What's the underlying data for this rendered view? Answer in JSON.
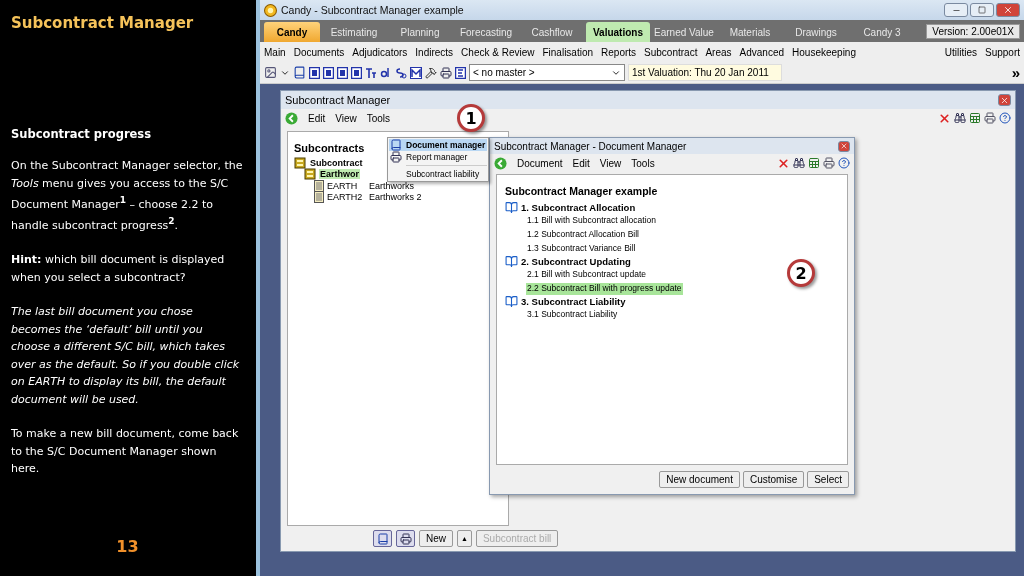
{
  "slide": {
    "title": "Subcontract Manager",
    "subtitle": "Subcontract progress",
    "paragraphs": [
      {
        "kind": "text",
        "text": "On the Subcontract Manager selector, the *Tools* menu gives you access to the S/C Document Manager$^{1}$ – choose 2.2 to handle subcontract progress$^{2}$."
      },
      {
        "kind": "text",
        "text": "**Hint:** which bill document is displayed when you select a subcontract?"
      },
      {
        "kind": "note",
        "text": "The last bill document you chose becomes the ‘default’ bill until you choose a different S/C bill, which takes over as the default.  So if you double click on EARTH to display its bill, the default document will be used."
      },
      {
        "kind": "text",
        "text": "To make a new bill document, come back to the S/C Document Manager shown here."
      }
    ],
    "page_number": "13"
  },
  "app": {
    "title": "Candy - Subcontract Manager example",
    "tabs": [
      {
        "label": "Candy",
        "kind": "brand",
        "selected": false
      },
      {
        "label": "Estimating",
        "kind": "tab",
        "selected": false
      },
      {
        "label": "Planning",
        "kind": "tab",
        "selected": false
      },
      {
        "label": "Forecasting",
        "kind": "tab",
        "selected": false
      },
      {
        "label": "Cashflow",
        "kind": "tab",
        "selected": false
      },
      {
        "label": "Valuations",
        "kind": "tab",
        "selected": true
      },
      {
        "label": "Earned Value",
        "kind": "tab",
        "selected": false
      },
      {
        "label": "Materials",
        "kind": "tab",
        "selected": false
      },
      {
        "label": "Drawings",
        "kind": "tab",
        "selected": false
      },
      {
        "label": "Candy 3",
        "kind": "tab",
        "selected": false
      }
    ],
    "version": "Version: 2.00e01X",
    "menu": [
      "Main",
      "Documents",
      "Adjudicators",
      "Indirects",
      "Check & Review",
      "Finalisation",
      "Reports",
      "Subcontract",
      "Areas",
      "Advanced",
      "Housekeeping"
    ],
    "menu_right": [
      "Utilities",
      "Support"
    ],
    "master_select": "< no master >",
    "valuation": "1st Valuation: Thu 20 Jan 2011",
    "chevron": "»"
  },
  "manager": {
    "title": "Subcontract Manager",
    "menu": [
      "Edit",
      "View",
      "Tools"
    ],
    "heading": "Subcontracts",
    "tree": [
      {
        "label": "Subcontract",
        "selected": false,
        "children": [
          {
            "label": "Earthwor",
            "selected": true,
            "children": [
              {
                "code": "EARTH",
                "label": "Earthworks",
                "selected": false
              },
              {
                "code": "EARTH2",
                "label": "Earthworks 2",
                "selected": false
              }
            ]
          }
        ]
      }
    ],
    "new_button": "New",
    "new_arrow": "▲",
    "bill_button": {
      "label": "Subcontract bill",
      "disabled": true
    }
  },
  "tools_menu": [
    {
      "label": "Document manager",
      "selected": true
    },
    {
      "label": "Report manager",
      "selected": false
    },
    {
      "label": "Subcontract liability",
      "selected": false
    }
  ],
  "document_manager": {
    "title": "Subcontract Manager - Document Manager",
    "menu": [
      "Document",
      "Edit",
      "View",
      "Tools"
    ],
    "heading": "Subcontract Manager example",
    "sections": [
      {
        "label": "1. Subcontract Allocation",
        "items": [
          {
            "label": "1.1 Bill with Subcontract allocation",
            "selected": false
          },
          {
            "label": "1.2 Subcontract Allocation Bill",
            "selected": false
          },
          {
            "label": "1.3 Subcontract Variance Bill",
            "selected": false
          }
        ]
      },
      {
        "label": "2. Subcontract Updating",
        "items": [
          {
            "label": "2.1 Bill with Subcontract update",
            "selected": false
          },
          {
            "label": "2.2 Subcontract Bill with progress update",
            "selected": true
          }
        ]
      },
      {
        "label": "3. Subcontract Liability",
        "items": [
          {
            "label": "3.1 Subcontract Liability",
            "selected": false
          }
        ]
      }
    ],
    "buttons": [
      "New document",
      "Customise",
      "Select"
    ]
  },
  "callouts": [
    "1",
    "2"
  ]
}
